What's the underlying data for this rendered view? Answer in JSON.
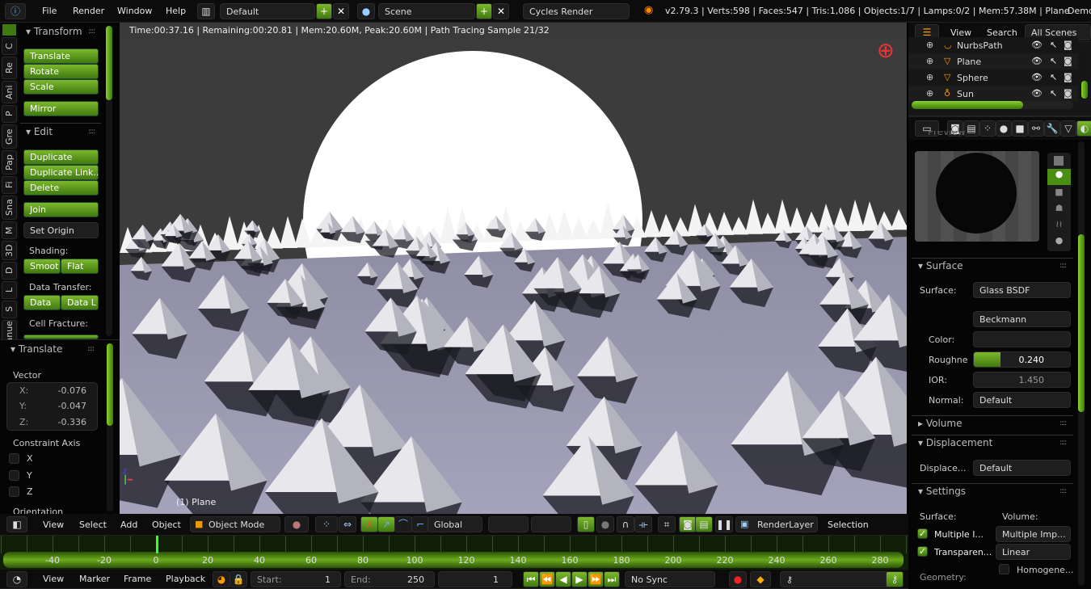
{
  "topbar": {
    "menus": [
      "File",
      "Render",
      "Window",
      "Help"
    ],
    "layout": "Default",
    "scene": "Scene",
    "engine": "Cycles Render",
    "stats": "v2.79.3 | Verts:598 | Faces:547 | Tris:1,086 | Objects:1/7 | Lamps:0/2 | Mem:57.38M | Plane",
    "right_label": "Demo"
  },
  "tool_tabs": [
    "C",
    "Re",
    "Ani",
    "P",
    "Gre",
    "Pap",
    "Fi",
    "Sna",
    "M",
    "3D",
    "D",
    "L",
    "S",
    "Manue"
  ],
  "toolshelf": {
    "transform_title": "Transform",
    "translate": "Translate",
    "rotate": "Rotate",
    "scale": "Scale",
    "mirror": "Mirror",
    "edit_title": "Edit",
    "duplicate": "Duplicate",
    "duplicate_linked": "Duplicate Link...",
    "delete": "Delete",
    "join": "Join",
    "set_origin": "Set Origin",
    "shading_label": "Shading:",
    "smooth": "Smoot",
    "flat": "Flat",
    "data_transfer_label": "Data Transfer:",
    "data": "Data",
    "data_l": "Data L",
    "cell_fracture_label": "Cell Fracture:"
  },
  "operator": {
    "title": "Translate",
    "vector_label": "Vector",
    "x_label": "X:",
    "x": "-0.076",
    "y_label": "Y:",
    "y": "-0.047",
    "z_label": "Z:",
    "z": "-0.336",
    "constraint_label": "Constraint Axis",
    "axes": [
      "X",
      "Y",
      "Z"
    ],
    "orientation_label": "Orientation"
  },
  "viewport": {
    "render_status": "Time:00:37.16 | Remaining:00:20.81 | Mem:20.60M, Peak:20.60M | Path Tracing Sample 21/32",
    "object_label": "(1) Plane",
    "progress": 0.656
  },
  "outliner": {
    "view": "View",
    "search": "Search",
    "filter": "All Scenes",
    "items": [
      {
        "name": "NurbsPath"
      },
      {
        "name": "Plane"
      },
      {
        "name": "Sphere"
      },
      {
        "name": "Sun"
      }
    ]
  },
  "properties": {
    "preview_title": "Preview",
    "surface_title": "Surface",
    "surface_label": "Surface:",
    "surface_value": "Glass BSDF",
    "distribution": "Beckmann",
    "color_label": "Color:",
    "roughness_label": "Roughne",
    "roughness_value": "0.240",
    "roughness": 0.24,
    "ior_label": "IOR:",
    "ior_value": "1.450",
    "normal_label": "Normal:",
    "normal_value": "Default",
    "volume_title": "Volume",
    "displacement_title": "Displacement",
    "displacement_label": "Displace...",
    "displacement_value": "Default",
    "settings_title": "Settings",
    "set_surface_label": "Surface:",
    "set_volume_label": "Volume:",
    "multiple_importance": "Multiple I...",
    "multiple_importance_checked": true,
    "transparent_shadows": "Transparen...",
    "transparent_shadows_checked": true,
    "volume_sampling": "Multiple Imp...",
    "volume_interp": "Linear",
    "homogeneous": "Homogene...",
    "homogeneous_checked": false,
    "geometry_label": "Geometry:"
  },
  "view3d_header": {
    "menus": [
      "View",
      "Select",
      "Add",
      "Object"
    ],
    "mode": "Object Mode",
    "orientation": "Global",
    "render_layer": "RenderLayer",
    "selection": "Selection"
  },
  "timeline": {
    "ticks": [
      "-40",
      "-20",
      "0",
      "20",
      "40",
      "60",
      "80",
      "100",
      "120",
      "140",
      "160",
      "180",
      "200",
      "220",
      "240",
      "260",
      "280"
    ],
    "current_frame": 1,
    "menus": [
      "View",
      "Marker",
      "Frame",
      "Playback"
    ],
    "start_label": "Start:",
    "start": "1",
    "end_label": "End:",
    "end": "250",
    "frame": "1",
    "sync": "No Sync"
  }
}
